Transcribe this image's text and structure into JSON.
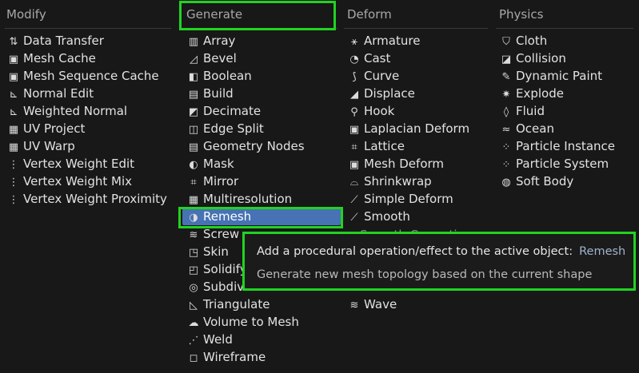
{
  "colors": {
    "accent": "#4772b3",
    "highlight_box": "#21d321",
    "menu_bg": "#181818"
  },
  "columns": [
    {
      "header": "Modify",
      "items": [
        {
          "icon": "data-transfer-icon",
          "glyph": "⇅",
          "label": "Data Transfer"
        },
        {
          "icon": "mesh-cache-icon",
          "glyph": "▣",
          "label": "Mesh Cache"
        },
        {
          "icon": "mesh-sequence-cache-icon",
          "glyph": "▣",
          "label": "Mesh Sequence Cache"
        },
        {
          "icon": "normal-edit-icon",
          "glyph": "⊾",
          "label": "Normal Edit"
        },
        {
          "icon": "weighted-normal-icon",
          "glyph": "⊾",
          "label": "Weighted Normal"
        },
        {
          "icon": "uv-project-icon",
          "glyph": "▦",
          "label": "UV Project"
        },
        {
          "icon": "uv-warp-icon",
          "glyph": "▦",
          "label": "UV Warp"
        },
        {
          "icon": "vertex-weight-edit-icon",
          "glyph": "⋮",
          "label": "Vertex Weight Edit"
        },
        {
          "icon": "vertex-weight-mix-icon",
          "glyph": "⋮",
          "label": "Vertex Weight Mix"
        },
        {
          "icon": "vertex-weight-proximity-icon",
          "glyph": "⋮",
          "label": "Vertex Weight Proximity"
        }
      ]
    },
    {
      "header": "Generate",
      "items": [
        {
          "icon": "array-icon",
          "glyph": "▥",
          "label": "Array"
        },
        {
          "icon": "bevel-icon",
          "glyph": "◿",
          "label": "Bevel"
        },
        {
          "icon": "boolean-icon",
          "glyph": "◧",
          "label": "Boolean"
        },
        {
          "icon": "build-icon",
          "glyph": "▤",
          "label": "Build"
        },
        {
          "icon": "decimate-icon",
          "glyph": "◩",
          "label": "Decimate"
        },
        {
          "icon": "edge-split-icon",
          "glyph": "◫",
          "label": "Edge Split"
        },
        {
          "icon": "geometry-nodes-icon",
          "glyph": "▤",
          "label": "Geometry Nodes"
        },
        {
          "icon": "mask-icon",
          "glyph": "◐",
          "label": "Mask"
        },
        {
          "icon": "mirror-icon",
          "glyph": "⌗",
          "label": "Mirror"
        },
        {
          "icon": "multiresolution-icon",
          "glyph": "▦",
          "label": "Multiresolution"
        },
        {
          "icon": "remesh-icon",
          "glyph": "◑",
          "label": "Remesh"
        },
        {
          "icon": "screw-icon",
          "glyph": "≋",
          "label": "Screw"
        },
        {
          "icon": "skin-icon",
          "glyph": "◳",
          "label": "Skin"
        },
        {
          "icon": "solidify-icon",
          "glyph": "◰",
          "label": "Solidify"
        },
        {
          "icon": "subdivision-surface-icon",
          "glyph": "◎",
          "label": "Subdivision Surface"
        },
        {
          "icon": "triangulate-icon",
          "glyph": "◺",
          "label": "Triangulate"
        },
        {
          "icon": "volume-to-mesh-icon",
          "glyph": "☁",
          "label": "Volume to Mesh"
        },
        {
          "icon": "weld-icon",
          "glyph": "⋰",
          "label": "Weld"
        },
        {
          "icon": "wireframe-icon",
          "glyph": "◻",
          "label": "Wireframe"
        }
      ]
    },
    {
      "header": "Deform",
      "items": [
        {
          "icon": "armature-icon",
          "glyph": "⚹",
          "label": "Armature"
        },
        {
          "icon": "cast-icon",
          "glyph": "◔",
          "label": "Cast"
        },
        {
          "icon": "curve-icon",
          "glyph": "⟆",
          "label": "Curve"
        },
        {
          "icon": "displace-icon",
          "glyph": "◢",
          "label": "Displace"
        },
        {
          "icon": "hook-icon",
          "glyph": "⚲",
          "label": "Hook"
        },
        {
          "icon": "laplacian-deform-icon",
          "glyph": "▣",
          "label": "Laplacian Deform"
        },
        {
          "icon": "lattice-icon",
          "glyph": "⌗",
          "label": "Lattice"
        },
        {
          "icon": "mesh-deform-icon",
          "glyph": "▣",
          "label": "Mesh Deform"
        },
        {
          "icon": "shrinkwrap-icon",
          "glyph": "⌓",
          "label": "Shrinkwrap"
        },
        {
          "icon": "simple-deform-icon",
          "glyph": "⟋",
          "label": "Simple Deform"
        },
        {
          "icon": "smooth-icon",
          "glyph": "⟋",
          "label": "Smooth"
        },
        {
          "icon": "wave-icon",
          "glyph": "≋",
          "label": "Wave"
        }
      ]
    },
    {
      "header": "Physics",
      "items": [
        {
          "icon": "cloth-icon",
          "glyph": "⛉",
          "label": "Cloth"
        },
        {
          "icon": "collision-icon",
          "glyph": "◪",
          "label": "Collision"
        },
        {
          "icon": "dynamic-paint-icon",
          "glyph": "✎",
          "label": "Dynamic Paint"
        },
        {
          "icon": "explode-icon",
          "glyph": "✷",
          "label": "Explode"
        },
        {
          "icon": "fluid-icon",
          "glyph": "◊",
          "label": "Fluid"
        },
        {
          "icon": "ocean-icon",
          "glyph": "≈",
          "label": "Ocean"
        },
        {
          "icon": "particle-instance-icon",
          "glyph": "⁘",
          "label": "Particle Instance"
        },
        {
          "icon": "particle-system-icon",
          "glyph": "⁘",
          "label": "Particle System"
        },
        {
          "icon": "soft-body-icon",
          "glyph": "◍",
          "label": "Soft Body"
        }
      ]
    }
  ],
  "tooltip": {
    "description": "Add a procedural operation/effect to the active object:",
    "operator": "Remesh",
    "detail": "Generate new mesh topology based on the current shape"
  },
  "ghost_text": "Smooth Corrective"
}
